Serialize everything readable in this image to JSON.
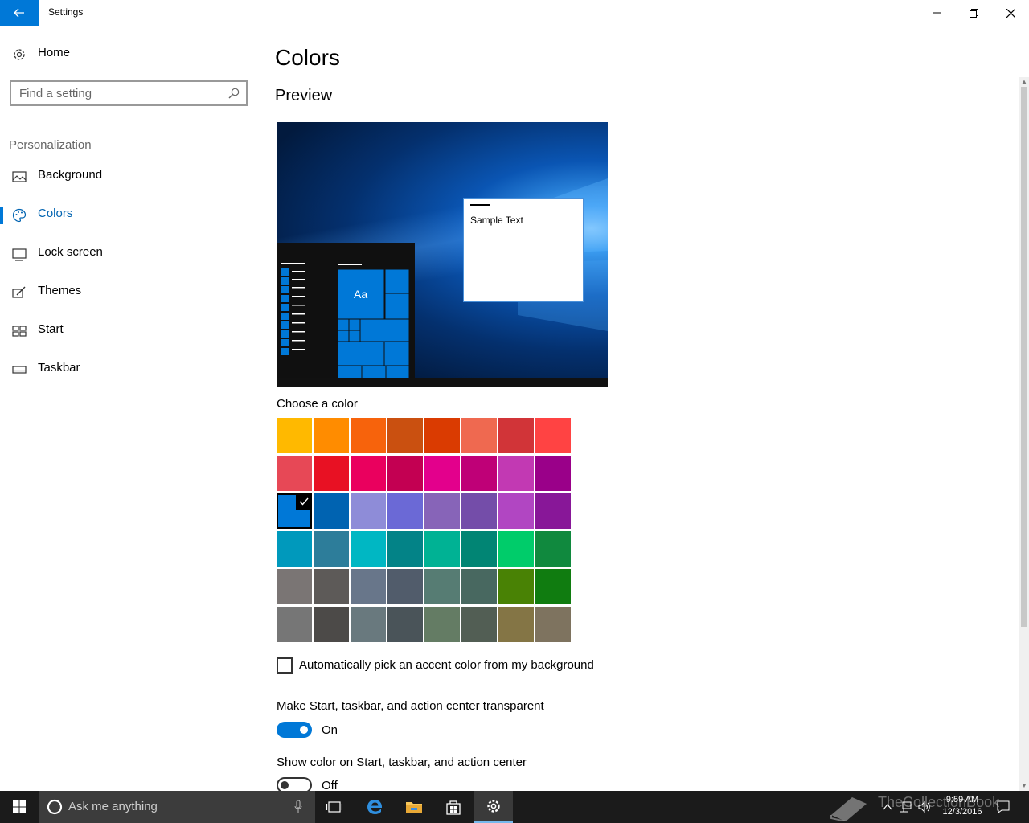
{
  "window": {
    "title": "Settings"
  },
  "nav": {
    "home_label": "Home",
    "search_placeholder": "Find a setting",
    "section_label": "Personalization",
    "items": [
      {
        "label": "Background",
        "icon": "picture-icon"
      },
      {
        "label": "Colors",
        "icon": "palette-icon",
        "active": true
      },
      {
        "label": "Lock screen",
        "icon": "lock-screen-icon"
      },
      {
        "label": "Themes",
        "icon": "themes-icon"
      },
      {
        "label": "Start",
        "icon": "start-icon"
      },
      {
        "label": "Taskbar",
        "icon": "taskbar-icon"
      }
    ]
  },
  "main": {
    "title": "Colors",
    "preview_heading": "Preview",
    "preview_sample_text": "Sample Text",
    "preview_tile_text": "Aa",
    "choose_color_label": "Choose a color",
    "selected_color": "#0078d7",
    "swatches": [
      [
        "#ffb900",
        "#ff8c00",
        "#f7630c",
        "#ca5010",
        "#da3b01",
        "#ef6950",
        "#d13438",
        "#ff4343"
      ],
      [
        "#e74856",
        "#e81123",
        "#ea005e",
        "#c30052",
        "#e3008c",
        "#bf0077",
        "#c239b3",
        "#9a0089"
      ],
      [
        "#0078d7",
        "#0063b1",
        "#8e8cd8",
        "#6b69d6",
        "#8764b8",
        "#744da9",
        "#b146c2",
        "#881798"
      ],
      [
        "#0099bc",
        "#2d7d9a",
        "#00b7c3",
        "#038387",
        "#00b294",
        "#018574",
        "#00cc6a",
        "#10893e"
      ],
      [
        "#7a7574",
        "#5d5a58",
        "#68768a",
        "#515c6b",
        "#567c73",
        "#486860",
        "#498205",
        "#107c10"
      ],
      [
        "#767676",
        "#4c4a48",
        "#69797e",
        "#4a5459",
        "#647c64",
        "#525e54",
        "#847545",
        "#7e735f"
      ]
    ],
    "auto_pick_label": "Automatically pick an accent color from my background",
    "auto_pick_checked": false,
    "transparent_label": "Make Start, taskbar, and action center transparent",
    "transparent_state": "On",
    "show_color_label": "Show color on Start, taskbar, and action center",
    "show_color_state": "Off"
  },
  "taskbar": {
    "search_placeholder": "Ask me anything",
    "time": "9:59 AM",
    "date": "12/3/2016",
    "watermark": "TheCollectionBook"
  },
  "colors": {
    "accent": "#0078d7",
    "taskbar_bg": "#1b1b1b"
  }
}
